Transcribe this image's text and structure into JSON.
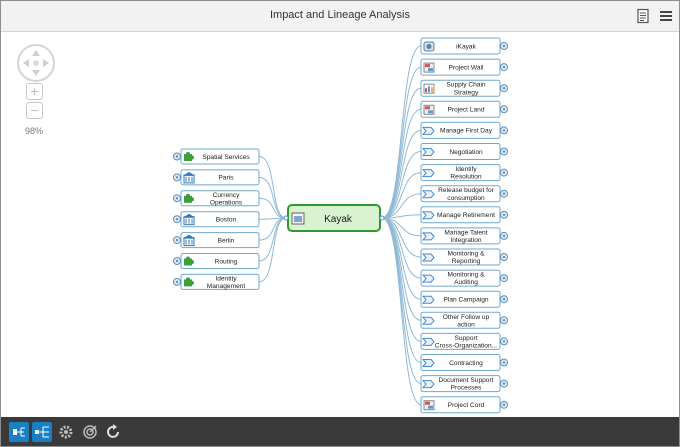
{
  "window": {
    "title": "Impact and Lineage Analysis"
  },
  "toolbar": {
    "icons": [
      "document-icon",
      "menu-icon"
    ]
  },
  "zoom": {
    "level": "98%"
  },
  "center": {
    "label": "Kayak"
  },
  "left_nodes": [
    {
      "label": "Spatial Services",
      "icon": "puzzle-icon"
    },
    {
      "label": "Paris",
      "icon": "building-icon"
    },
    {
      "label": "Currency Operations",
      "icon": "puzzle-icon"
    },
    {
      "label": "Boston",
      "icon": "building-icon"
    },
    {
      "label": "Berlin",
      "icon": "building-icon"
    },
    {
      "label": "Routing",
      "icon": "puzzle-icon"
    },
    {
      "label": "Identity Management",
      "icon": "puzzle-icon"
    }
  ],
  "right_nodes": [
    {
      "label": "iKayak",
      "icon": "app-icon"
    },
    {
      "label": "Project Wall",
      "icon": "project-icon"
    },
    {
      "label": "Supply Chain Strategy",
      "icon": "strategy-icon"
    },
    {
      "label": "Project Land",
      "icon": "project-icon"
    },
    {
      "label": "Manage First Day",
      "icon": "process-icon"
    },
    {
      "label": "Negotiation",
      "icon": "process-icon"
    },
    {
      "label": "Identify Resolution",
      "icon": "process-icon"
    },
    {
      "label": "Release budget for consumption",
      "icon": "process-icon"
    },
    {
      "label": "Manage Retirement",
      "icon": "process-icon"
    },
    {
      "label": "Manage Talent Integration",
      "icon": "process-icon"
    },
    {
      "label": "Monitoring & Reporting",
      "icon": "process-icon"
    },
    {
      "label": "Monitoring & Auditing",
      "icon": "process-icon"
    },
    {
      "label": "Plan Campaign",
      "icon": "process-icon"
    },
    {
      "label": "Other Follow up action",
      "icon": "process-icon"
    },
    {
      "label": "Support Cross-Organization...",
      "icon": "process-icon"
    },
    {
      "label": "Contracting",
      "icon": "process-icon"
    },
    {
      "label": "Document Support Processes",
      "icon": "process-icon"
    },
    {
      "label": "Project Cord",
      "icon": "project-icon"
    }
  ],
  "bottom_toolbar": [
    "layout-left-icon",
    "layout-tree-icon",
    "settings-icon",
    "target-icon",
    "refresh-icon"
  ],
  "colors": {
    "accent": "#1b7fc3",
    "node_border": "#6fa8cc",
    "center_fill": "#d9f2d0",
    "center_border": "#2e9a2e",
    "edge": "#8fb9d6"
  }
}
